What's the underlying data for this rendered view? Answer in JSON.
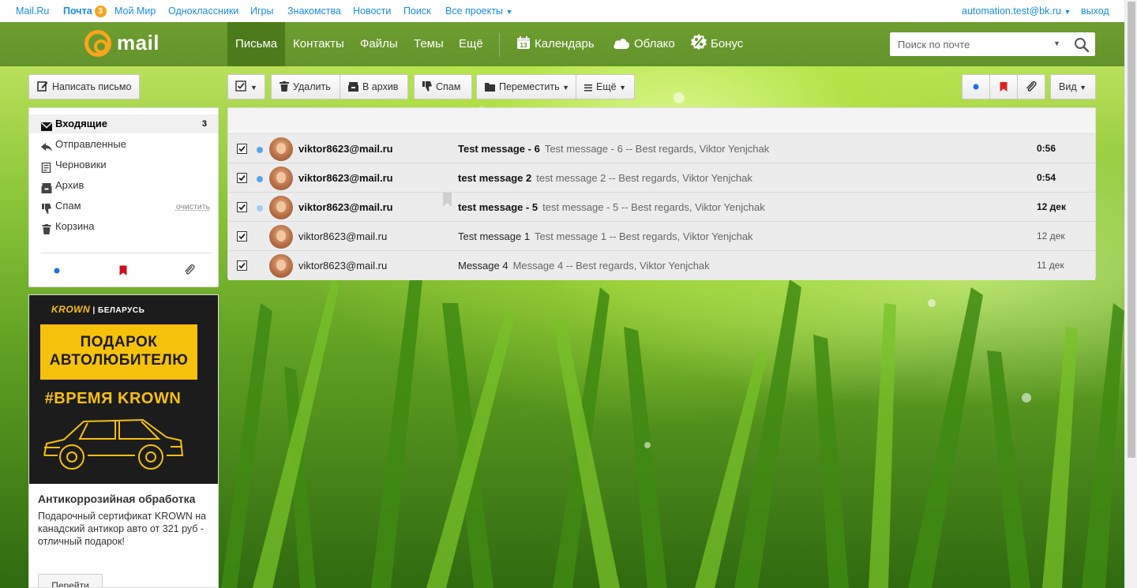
{
  "project_bar": {
    "links": [
      "Mail.Ru",
      "Почта",
      "Мой Мир",
      "Одноклассники",
      "Игры",
      "Знакомства",
      "Новости",
      "Поиск",
      "Все проекты"
    ],
    "mail_badge": "3",
    "user": "automation.test@bk.ru",
    "logout": "выход"
  },
  "header": {
    "logo_text": "mail",
    "nav": [
      "Письма",
      "Контакты",
      "Файлы",
      "Темы",
      "Ещё"
    ],
    "calendar_day": "13",
    "services": [
      "Календарь",
      "Облако",
      "Бонус"
    ],
    "search_placeholder": "Поиск по почте"
  },
  "toolbar": {
    "compose": "Написать письмо",
    "delete": "Удалить",
    "archive": "В архив",
    "spam": "Спам",
    "move": "Переместить",
    "more": "Ещё",
    "view": "Вид"
  },
  "folders": [
    {
      "name": "Входящие",
      "count": "3",
      "icon": "envelope-icon"
    },
    {
      "name": "Отправленные",
      "icon": "reply-icon"
    },
    {
      "name": "Черновики",
      "icon": "draft-icon"
    },
    {
      "name": "Архив",
      "icon": "archive-icon"
    },
    {
      "name": "Спам",
      "action": "очистить",
      "icon": "thumb-down-icon"
    },
    {
      "name": "Корзина",
      "icon": "trash-icon"
    }
  ],
  "ad": {
    "brand": "KROWN",
    "region": "БЕЛАРУСЬ",
    "banner_line1": "ПОДАРОК",
    "banner_line2": "АВТОЛЮБИТЕЛЮ",
    "hashtag": "#ВРЕМЯ KROWN",
    "title": "Антикоррозийная обработка",
    "description": "Подарочный сертификат KROWN на канадский антикор авто от 321 руб - отличный подарок!",
    "button": "Перейти"
  },
  "messages": [
    {
      "from": "viktor8623@mail.ru",
      "subject": "Test message - 6",
      "snippet": "Test message - 6 -- Best regards, Viktor Yenjchak",
      "time": "0:56",
      "unread": true
    },
    {
      "from": "viktor8623@mail.ru",
      "subject": "test message 2",
      "snippet": "test message 2 -- Best regards, Viktor Yenjchak",
      "time": "0:54",
      "unread": true
    },
    {
      "from": "viktor8623@mail.ru",
      "subject": "test message - 5",
      "snippet": "test message - 5 -- Best regards, Viktor Yenjchak",
      "time": "12 дек",
      "unread": true
    },
    {
      "from": "viktor8623@mail.ru",
      "subject": "Test message 1",
      "snippet": "Test message 1 -- Best regards, Viktor Yenjchak",
      "time": "12 дек",
      "unread": false
    },
    {
      "from": "viktor8623@mail.ru",
      "subject": "Message 4",
      "snippet": "Message 4 -- Best regards, Viktor Yenjchak",
      "time": "11 дек",
      "unread": false
    }
  ],
  "colors": {
    "header_green": "#6b9a2e",
    "active_tab": "#4d7a1a",
    "logo_orange": "#f7a51c",
    "link_blue": "#168de2",
    "unread_dot": "#5aa4e6",
    "flag_red": "#e02020",
    "ad_yellow": "#f6c10a"
  }
}
